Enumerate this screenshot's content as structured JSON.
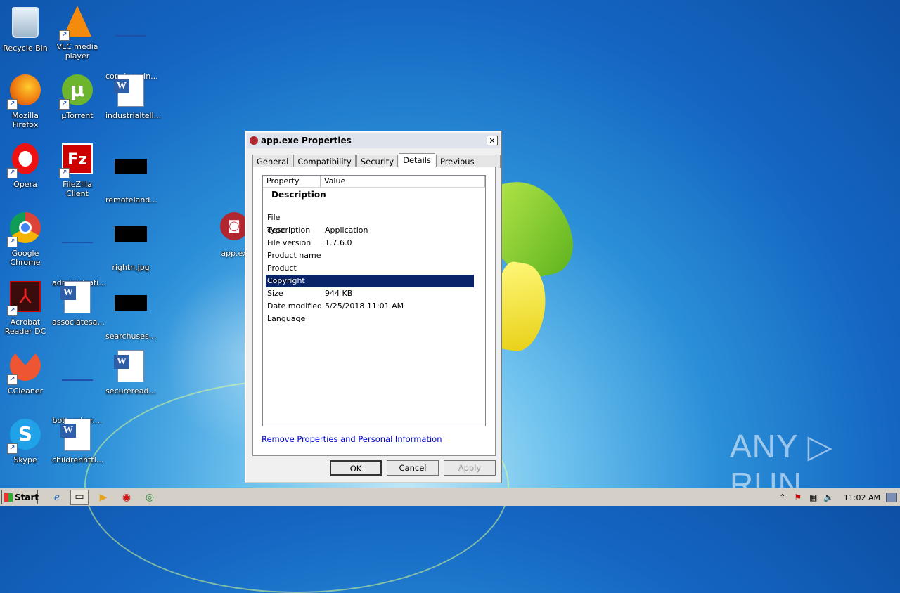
{
  "desktop": {
    "icons": [
      {
        "label": "Recycle Bin"
      },
      {
        "label": "VLC media player"
      },
      {
        "label": "copylearnin..."
      },
      {
        "label": "Mozilla Firefox"
      },
      {
        "label": "µTorrent"
      },
      {
        "label": "industrialtell..."
      },
      {
        "label": "Opera"
      },
      {
        "label": "FileZilla Client"
      },
      {
        "label": "remoteland..."
      },
      {
        "label": "app.ex"
      },
      {
        "label": "Google Chrome"
      },
      {
        "label": "administrati..."
      },
      {
        "label": "rightn.jpg"
      },
      {
        "label": "Acrobat Reader DC"
      },
      {
        "label": "associatesa..."
      },
      {
        "label": "searchuses..."
      },
      {
        "label": "CCleaner"
      },
      {
        "label": "bottomher...."
      },
      {
        "label": "secureread..."
      },
      {
        "label": "Skype"
      },
      {
        "label": "childrenhttl..."
      }
    ]
  },
  "dialog": {
    "title": "app.exe Properties",
    "close": "✕",
    "tabs": [
      "General",
      "Compatibility",
      "Security",
      "Details",
      "Previous Versions"
    ],
    "active_tab": "Details",
    "columns": {
      "property": "Property",
      "value": "Value"
    },
    "group": "Description",
    "rows": [
      {
        "property": "File description",
        "value": ""
      },
      {
        "property": "Type",
        "value": "Application"
      },
      {
        "property": "File version",
        "value": "1.7.6.0"
      },
      {
        "property": "Product name",
        "value": ""
      },
      {
        "property": "Product version",
        "value": ""
      },
      {
        "property": "Copyright",
        "value": "",
        "selected": true
      },
      {
        "property": "Size",
        "value": "944 KB"
      },
      {
        "property": "Date modified",
        "value": "5/25/2018 11:01 AM"
      },
      {
        "property": "Language",
        "value": ""
      }
    ],
    "link": "Remove Properties and Personal Information",
    "buttons": {
      "ok": "OK",
      "cancel": "Cancel",
      "apply": "Apply"
    }
  },
  "taskbar": {
    "start": "Start",
    "clock": "11:02 AM"
  },
  "watermark": "ANY ▷ RUN",
  "colors": {
    "selection": "#0a246a",
    "link": "#0000cc"
  }
}
